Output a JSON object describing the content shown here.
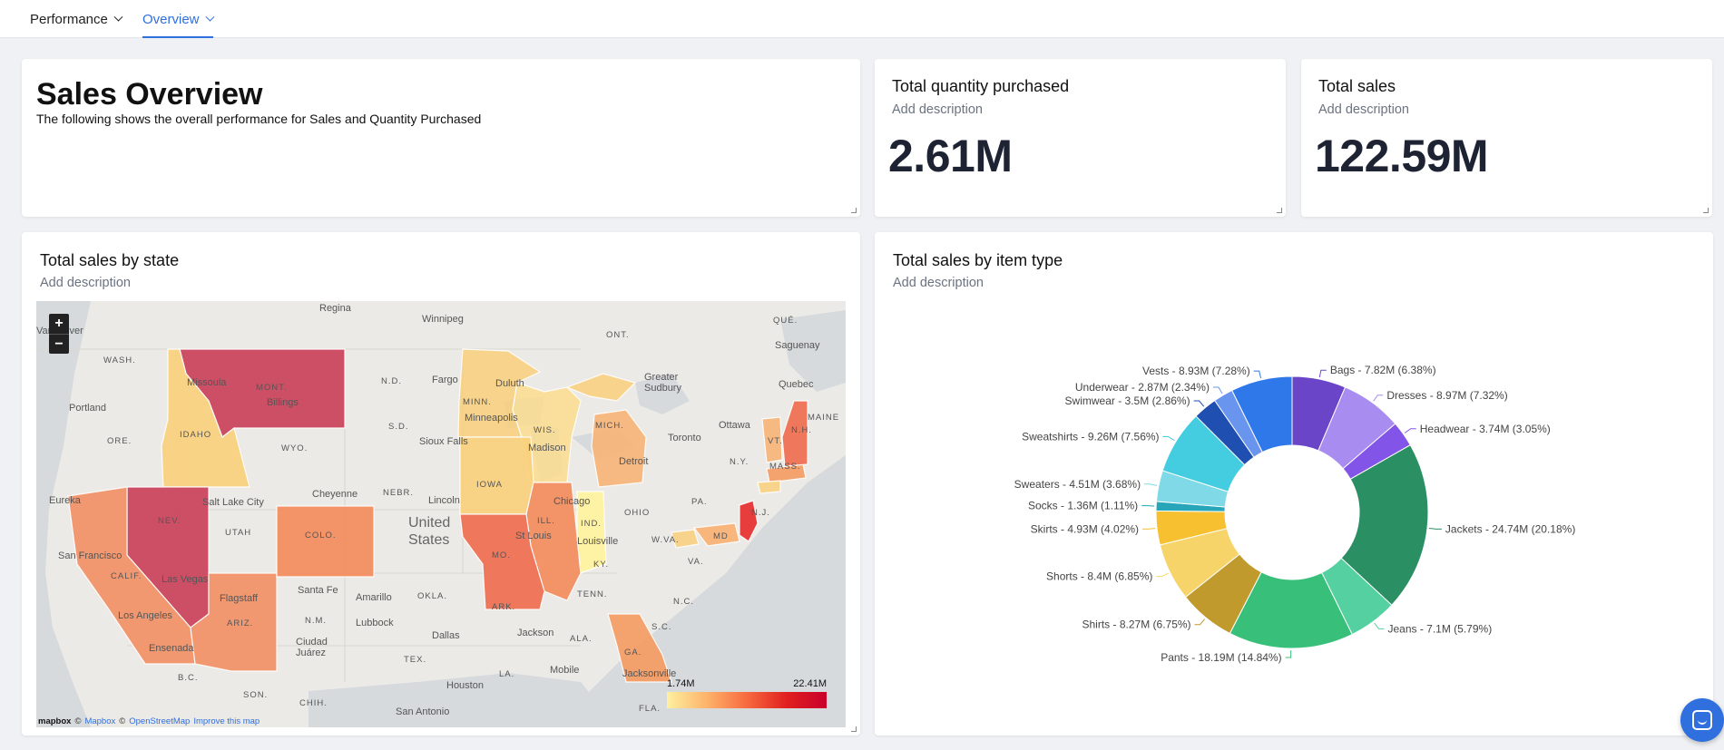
{
  "tabs": [
    {
      "label": "Performance",
      "active": false
    },
    {
      "label": "Overview",
      "active": true
    }
  ],
  "overview": {
    "title": "Sales Overview",
    "subtitle": "The following shows the overall performance for Sales and Quantity Purchased"
  },
  "kpis": {
    "quantity": {
      "title": "Total quantity purchased",
      "description": "Add description",
      "value": "2.61M"
    },
    "sales": {
      "title": "Total sales",
      "description": "Add description",
      "value": "122.59M"
    }
  },
  "map_card": {
    "title": "Total sales by state",
    "description": "Add description",
    "zoom_in": "+",
    "zoom_out": "−",
    "legend_min": "1.74M",
    "legend_max": "22.41M",
    "legend_colors": [
      "#fff0a0",
      "#fdb36a",
      "#f86a3f",
      "#e02020",
      "#c8002a"
    ],
    "attribution": {
      "logo": "mapbox",
      "c1": "©",
      "mapbox": "Mapbox",
      "c2": "©",
      "osm": "OpenStreetMap",
      "improve": "Improve this map"
    },
    "place_labels": [
      "Regina",
      "Winnipeg",
      "ONT.",
      "QUÉ.",
      "Saguenay",
      "Vancouver",
      "WASH.",
      "Missoula",
      "MONT.",
      "Billings",
      "N.D.",
      "Fargo",
      "Duluth",
      "MINN.",
      "Greater Sudbury",
      "Quebec",
      "Portland",
      "ORE.",
      "IDAHO",
      "WYO.",
      "S.D.",
      "Sioux Falls",
      "Minneapolis",
      "WIS.",
      "Madison",
      "MICH.",
      "Ottawa",
      "Toronto",
      "MAINE",
      "VT.",
      "N.H.",
      "MASS.",
      "N.Y.",
      "Detroit",
      "Eureka",
      "NEV.",
      "Salt Lake City",
      "Cheyenne",
      "NEBR.",
      "Lincoln",
      "IOWA",
      "Chicago",
      "ILL.",
      "IND.",
      "OHIO",
      "PA.",
      "N.J.",
      "San Francisco",
      "CALIF.",
      "UTAH",
      "COLO.",
      "United States",
      "St Louis",
      "Louisville",
      "W.VA.",
      "MD",
      "Las Vegas",
      "MO.",
      "KY.",
      "VA.",
      "Los Angeles",
      "Flagstaff",
      "ARIZ.",
      "Santa Fe",
      "Amarillo",
      "OKLA.",
      "TENN.",
      "N.C.",
      "N.M.",
      "Lubbock",
      "ARK.",
      "S.C.",
      "Ensenada",
      "Ciudad Juárez",
      "Dallas",
      "Jackson",
      "ALA.",
      "GA.",
      "B.C.",
      "TEX.",
      "Mobile",
      "Jacksonville",
      "SON.",
      "CHIH.",
      "LA.",
      "Houston",
      "San Antonio",
      "FLA."
    ]
  },
  "donut_card": {
    "title": "Total sales by item type",
    "description": "Add description"
  },
  "chart_data": {
    "type": "pie",
    "donut": true,
    "title": "Total sales by item type",
    "unit": "M",
    "categories": [
      "Bags",
      "Dresses",
      "Headwear",
      "Jackets",
      "Jeans",
      "Pants",
      "Shirts",
      "Shorts",
      "Skirts",
      "Socks",
      "Sweaters",
      "Sweatshirts",
      "Swimwear",
      "Underwear",
      "Vests"
    ],
    "values": [
      7.82,
      8.97,
      3.74,
      24.74,
      7.1,
      18.19,
      8.27,
      8.4,
      4.93,
      1.36,
      4.51,
      9.26,
      3.5,
      2.87,
      8.93
    ],
    "percentages": [
      6.38,
      7.32,
      3.05,
      20.18,
      5.79,
      14.84,
      6.75,
      6.85,
      4.02,
      1.11,
      3.68,
      7.56,
      2.86,
      2.34,
      7.28
    ],
    "labels": [
      "Bags - 7.82M (6.38%)",
      "Dresses - 8.97M (7.32%)",
      "Headwear - 3.74M (3.05%)",
      "Jackets - 24.74M (20.18%)",
      "Jeans - 7.1M (5.79%)",
      "Pants - 18.19M (14.84%)",
      "Shirts - 8.27M (6.75%)",
      "Shorts - 8.4M (6.85%)",
      "Skirts - 4.93M (4.02%)",
      "Socks - 1.36M (1.11%)",
      "Sweaters - 4.51M (3.68%)",
      "Sweatshirts - 9.26M (7.56%)",
      "Swimwear - 3.5M (2.86%)",
      "Underwear - 2.87M (2.34%)",
      "Vests - 8.93M (7.28%)"
    ],
    "colors": [
      "#6a45c7",
      "#a98cf0",
      "#8354e8",
      "#2a8f62",
      "#55d0a0",
      "#38c07a",
      "#c19a2e",
      "#f6d46a",
      "#f6c030",
      "#26a6b8",
      "#7fd9e6",
      "#44cde0",
      "#1f4fb0",
      "#6a95ef",
      "#2f78ea"
    ]
  },
  "chat_button": {
    "icon": "chat-icon"
  }
}
